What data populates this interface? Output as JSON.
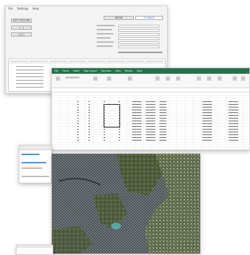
{
  "app_window": {
    "menu": [
      "File",
      "Settings",
      "Help"
    ],
    "buttons": [
      "EXIT TEXTURE",
      "[ · ]",
      "[ ] [ ]"
    ],
    "action_button": "BEGIN",
    "status_button": "STORAGE",
    "form_labels": [
      "",
      "",
      "",
      "",
      "",
      "",
      ""
    ],
    "status_line": ""
  },
  "excel_window": {
    "tabs": [
      "File",
      "Home",
      "Insert",
      "Page Layout",
      "Formulas",
      "Data",
      "Review",
      "View"
    ]
  },
  "colors": {
    "excel_green": "#217346",
    "app_bg": "#f3f3f3",
    "map_dark": "#4a5458",
    "map_green": "#6b7a4e",
    "water": "#5aa6a8"
  }
}
